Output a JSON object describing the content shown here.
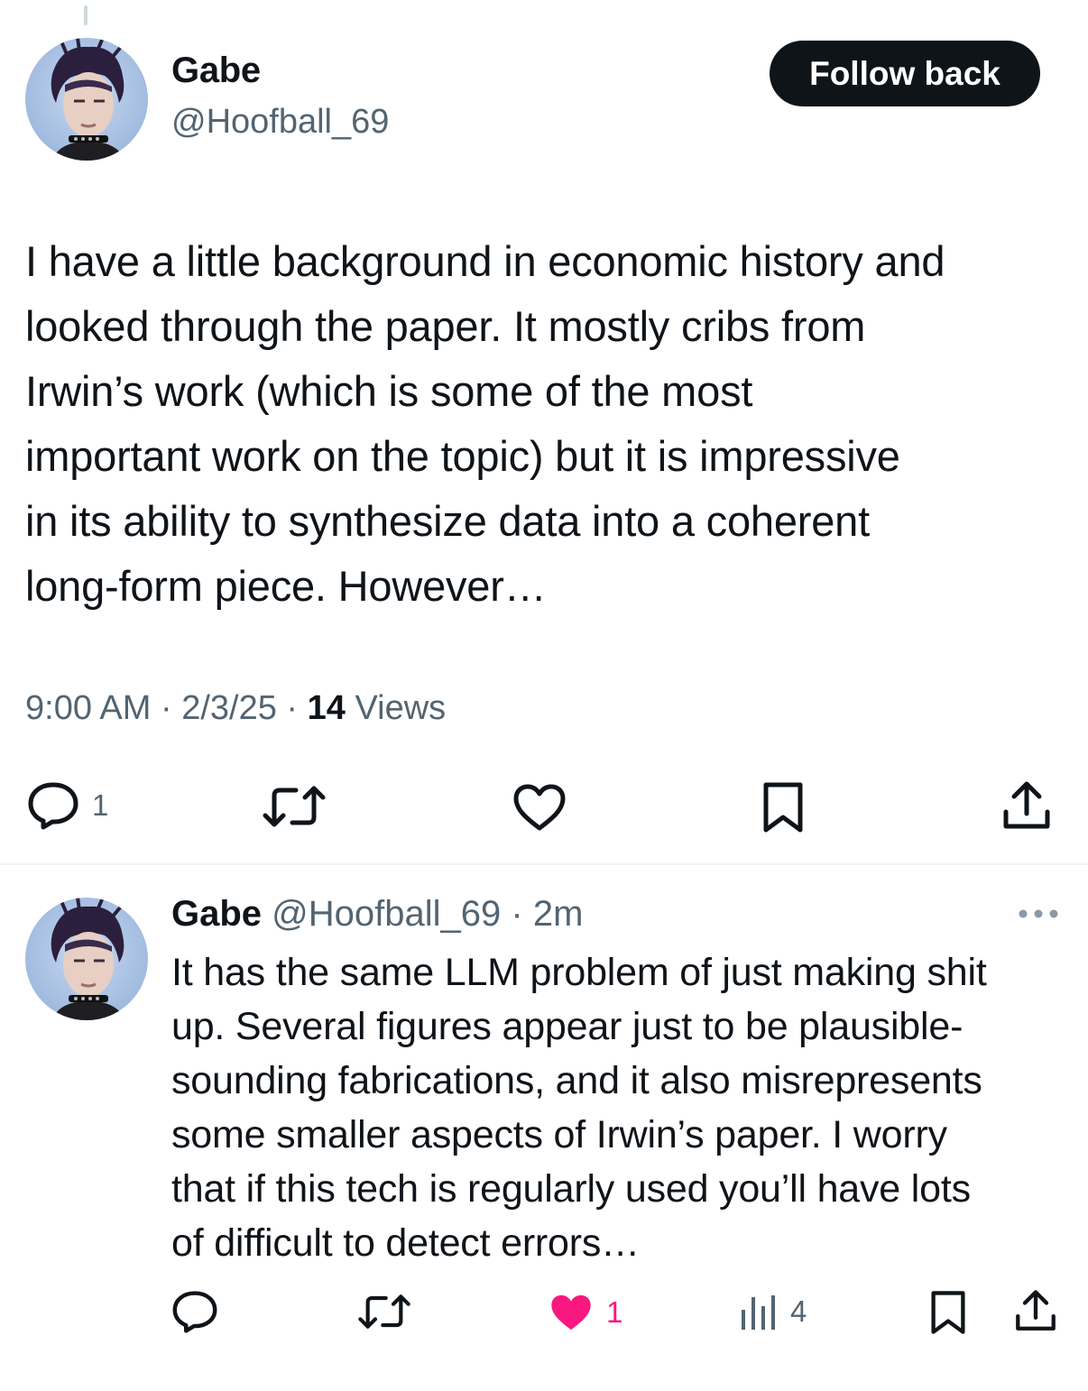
{
  "main_tweet": {
    "author_name": "Gabe",
    "author_handle": "@Hoofball_69",
    "follow_label": "Follow back",
    "text": "I have a little background in economic history and\nlooked through the paper. It mostly cribs from\nIrwin’s work (which is some of the most\nimportant work on the topic) but it is impressive\nin its ability to synthesize data into a coherent\nlong-form piece. However…",
    "time": "9:00 AM",
    "date": "2/3/25",
    "views_count": "14",
    "views_label": "Views",
    "separator": "·",
    "actions": {
      "reply_icon": "reply-icon",
      "reply_count": "1",
      "repost_icon": "repost-icon",
      "like_icon": "heart-icon",
      "bookmark_icon": "bookmark-icon",
      "share_icon": "share-icon"
    }
  },
  "reply": {
    "author_name": "Gabe",
    "author_handle": "@Hoofball_69",
    "time_ago": "· 2m",
    "text": "It has the same LLM problem of just making shit\nup. Several figures appear just to be plausible-\nsounding fabrications, and it also misrepresents\nsome smaller aspects of Irwin’s paper.  I worry\nthat if this tech is regularly used you’ll have lots\nof difficult to detect errors…",
    "actions": {
      "like_count": "1",
      "views_count": "4",
      "liked": true,
      "like_color": "#f91880"
    }
  },
  "colors": {
    "text_primary": "#0f1419",
    "text_secondary": "#536471",
    "like_active": "#f91880",
    "divider": "#eff3f4"
  }
}
